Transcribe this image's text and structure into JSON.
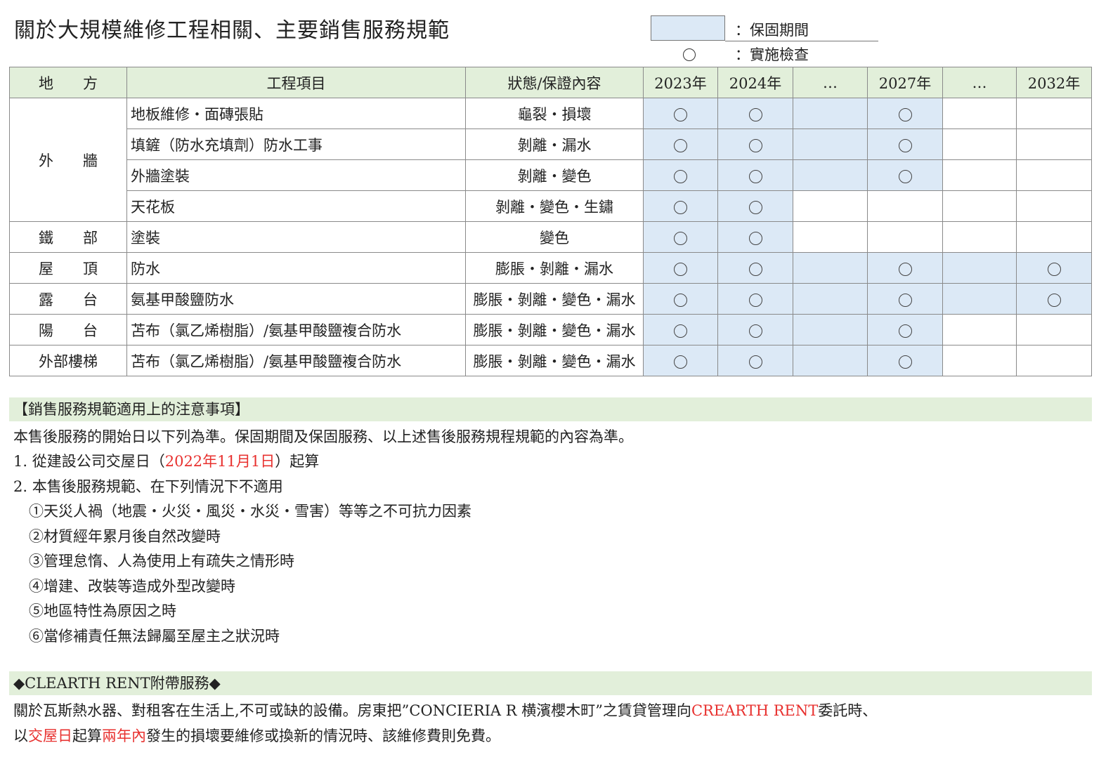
{
  "title": "關於大規模維修工程相關、主要銷售服務規範",
  "legend": {
    "warranty_label": "：保固期間",
    "inspection_symbol": "○",
    "inspection_label": "：實施檢查"
  },
  "table": {
    "headers": [
      "地　　方",
      "工程項目",
      "狀態/保證內容",
      "2023年",
      "2024年",
      "…",
      "2027年",
      "…",
      "2032年"
    ],
    "groups": [
      {
        "place": "外　　牆",
        "rows": [
          {
            "item": "地板維修・面磚張貼",
            "status": "龜裂・損壞",
            "blue": [
              1,
              1,
              1,
              1,
              0,
              0
            ],
            "circles": [
              1,
              1,
              0,
              1,
              0,
              0
            ]
          },
          {
            "item": "填鏟（防水充填劑）防水工事",
            "status": "剝離・漏水",
            "blue": [
              1,
              1,
              1,
              1,
              0,
              0
            ],
            "circles": [
              1,
              1,
              0,
              1,
              0,
              0
            ]
          },
          {
            "item": "外牆塗裝",
            "status": "剝離・變色",
            "blue": [
              1,
              1,
              1,
              1,
              0,
              0
            ],
            "circles": [
              1,
              1,
              0,
              1,
              0,
              0
            ]
          },
          {
            "item": "天花板",
            "status": "剝離・變色・生鏽",
            "blue": [
              1,
              1,
              0,
              0,
              0,
              0
            ],
            "circles": [
              1,
              1,
              0,
              0,
              0,
              0
            ]
          }
        ]
      },
      {
        "place": "鐵　　部",
        "rows": [
          {
            "item": "塗裝",
            "status": "變色",
            "blue": [
              1,
              1,
              0,
              0,
              0,
              0
            ],
            "circles": [
              1,
              1,
              0,
              0,
              0,
              0
            ]
          }
        ]
      },
      {
        "place": "屋　　頂",
        "rows": [
          {
            "item": "防水",
            "status": "膨脹・剝離・漏水",
            "blue": [
              1,
              1,
              1,
              1,
              1,
              1
            ],
            "circles": [
              1,
              1,
              0,
              1,
              0,
              1
            ]
          }
        ]
      },
      {
        "place": "露　　台",
        "rows": [
          {
            "item": "氨基甲酸鹽防水",
            "status": "膨脹・剝離・變色・漏水",
            "blue": [
              1,
              1,
              1,
              1,
              1,
              1
            ],
            "circles": [
              1,
              1,
              0,
              1,
              0,
              1
            ]
          }
        ]
      },
      {
        "place": "陽　　台",
        "rows": [
          {
            "item": "苫布（氯乙烯樹脂）/氨基甲酸鹽複合防水",
            "status": "膨脹・剝離・變色・漏水",
            "blue": [
              1,
              1,
              1,
              1,
              0,
              0
            ],
            "circles": [
              1,
              1,
              0,
              1,
              0,
              0
            ]
          }
        ]
      },
      {
        "place": "外部樓梯",
        "rows": [
          {
            "item": "苫布（氯乙烯樹脂）/氨基甲酸鹽複合防水",
            "status": "膨脹・剝離・變色・漏水",
            "blue": [
              1,
              1,
              1,
              1,
              0,
              0
            ],
            "circles": [
              1,
              1,
              0,
              1,
              0,
              0
            ]
          }
        ]
      }
    ]
  },
  "notes": {
    "heading": "【銷售服務規範適用上的注意事項】",
    "intro": "本售後服務的開始日以下列為準。保固期間及保固服務、以上述售後服務規程規範的內容為準。",
    "item1_prefix": "1. 從建設公司交屋日（",
    "item1_date": "2022年11月1日",
    "item1_suffix": "）起算",
    "item2": "2. 本售後服務規範、在下列情況下不適用",
    "exclusions": [
      "①天災人禍（地震・火災・風災・水災・雪害）等等之不可抗力因素",
      "②材質經年累月後自然改變時",
      "③管理怠惰、人為使用上有疏失之情形時",
      "④增建、改裝等造成外型改變時",
      "⑤地區特性為原因之時",
      "⑥當修補責任無法歸屬至屋主之狀況時"
    ]
  },
  "service": {
    "heading": "◆CLEARTH RENT附帶服務◆",
    "line1_a": "關於瓦斯熱水器、對租客在生活上,不可或缺的設備。房東把”CONCIERIA R 横濱櫻木町”之賃貸管理向",
    "line1_red": "CREARTH RENT",
    "line1_b": "委託時、",
    "line2_a": "以",
    "line2_red1": "交屋日",
    "line2_b": "起算",
    "line2_red2": "兩年內",
    "line2_c": "發生的損壞要維修或換新的情況時、該維修費則免費。"
  },
  "colors": {
    "header_green": "#e2efda",
    "warranty_blue": "#dce9f6",
    "highlight_red": "#e8312f"
  }
}
